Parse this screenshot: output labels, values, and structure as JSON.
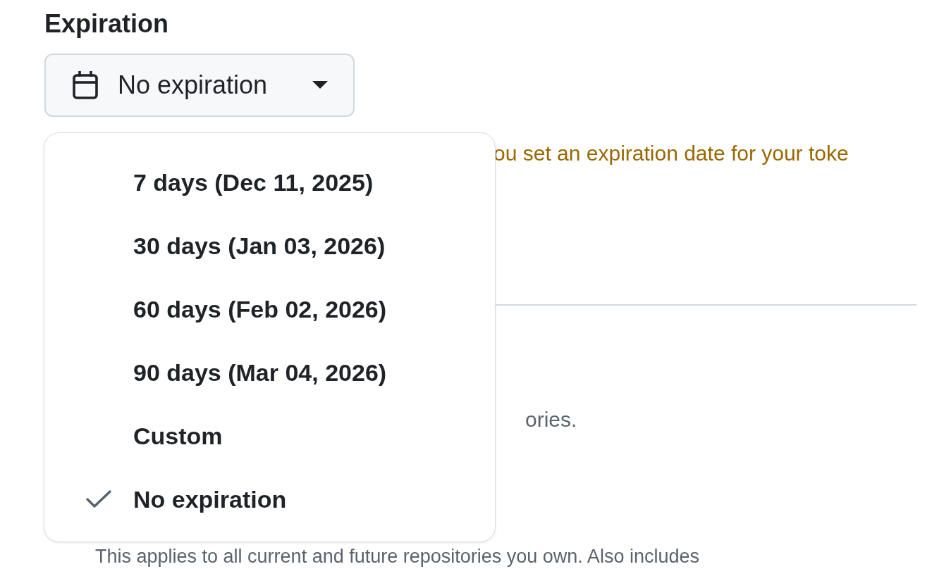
{
  "field": {
    "label": "Expiration",
    "value": "No expiration"
  },
  "warning": "ou set an expiration date for your toke",
  "section_text": "ories.",
  "note": "This applies to all current and future repositories you own. Also includes",
  "menu": {
    "items": [
      {
        "label": "7 days (Dec 11, 2025)",
        "selected": false
      },
      {
        "label": "30 days (Jan 03, 2026)",
        "selected": false
      },
      {
        "label": "60 days (Feb 02, 2026)",
        "selected": false
      },
      {
        "label": "90 days (Mar 04, 2026)",
        "selected": false
      },
      {
        "label": "Custom",
        "selected": false
      },
      {
        "label": "No expiration",
        "selected": true
      }
    ]
  }
}
